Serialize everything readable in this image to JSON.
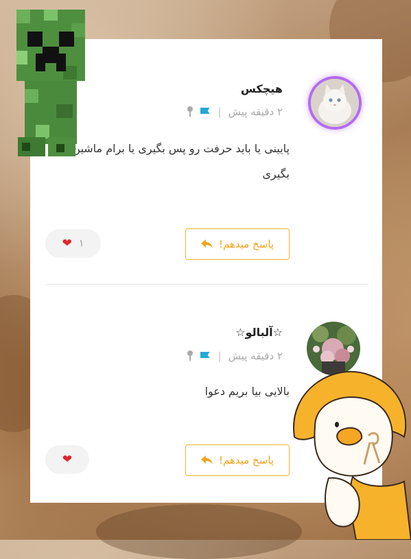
{
  "comments": [
    {
      "username": "هیچکس",
      "time": "۲ دقیقه پیش",
      "separator": "|",
      "text": "پایینی یا باید حرفت رو پس بگیری یا برام ماشین بگیری",
      "reply_label": "پاسخ میدهم!",
      "like_count": "۱",
      "avatar": "white-kitten"
    },
    {
      "username": "☆آلبالو☆",
      "time": "۲ دقیقه پیش",
      "separator": "|",
      "text": "بالایی بیا بریم دعوا",
      "reply_label": "پاسخ میدهم!",
      "like_count": "",
      "avatar": "flower-photo"
    }
  ],
  "icons": {
    "location": "pin-icon",
    "report": "flag-icon",
    "reply": "reply-arrow-icon",
    "like": "heart-icon"
  },
  "colors": {
    "accent": "#f5b526",
    "flag": "#22a9d6",
    "heart": "#e0262c",
    "avatar_glow": "#b46bf0"
  },
  "stickers": [
    "creeper-sticker",
    "duck-sticker"
  ]
}
